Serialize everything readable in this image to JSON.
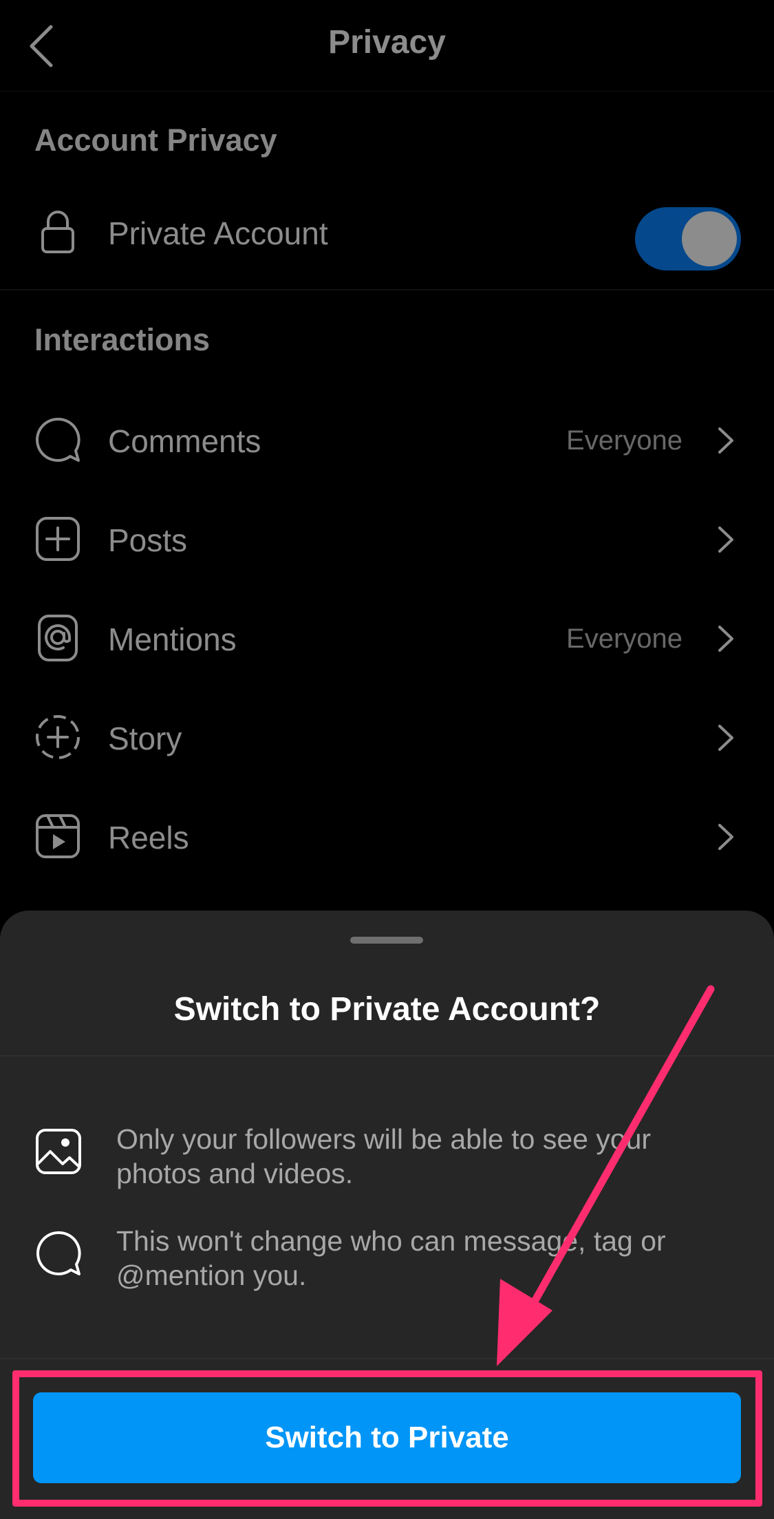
{
  "header": {
    "title": "Privacy"
  },
  "account_privacy": {
    "section_title": "Account Privacy",
    "private_account_label": "Private Account",
    "private_account_on": true
  },
  "interactions": {
    "section_title": "Interactions",
    "items": [
      {
        "label": "Comments",
        "value": "Everyone",
        "icon": "comment-bubble-icon"
      },
      {
        "label": "Posts",
        "value": "",
        "icon": "plus-square-icon"
      },
      {
        "label": "Mentions",
        "value": "Everyone",
        "icon": "at-sign-icon"
      },
      {
        "label": "Story",
        "value": "",
        "icon": "dashed-plus-circle-icon"
      },
      {
        "label": "Reels",
        "value": "",
        "icon": "reels-icon"
      }
    ]
  },
  "sheet": {
    "title": "Switch to Private Account?",
    "items": [
      {
        "icon": "photo-icon",
        "text": "Only your followers will be able to see your photos and videos."
      },
      {
        "icon": "message-bubble-icon",
        "text": "This won't change who can message, tag or @mention you."
      }
    ],
    "confirm_label": "Switch to Private"
  },
  "colors": {
    "accent_blue": "#0095f6",
    "toggle_blue": "#0a84ff",
    "annotation_pink": "#ff2d6f",
    "sheet_bg": "#262626"
  }
}
